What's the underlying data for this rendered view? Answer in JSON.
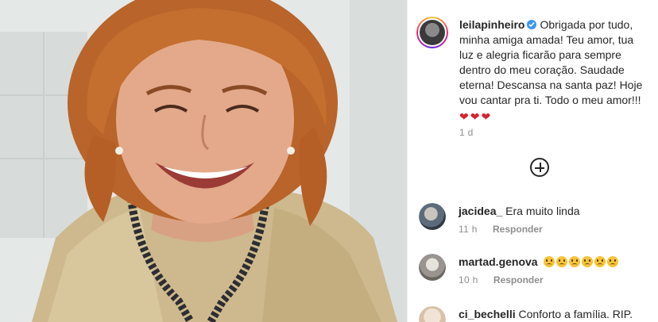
{
  "post": {
    "image_alt": "Smiling woman with short auburn hair wearing a gold satin blouse and beaded necklace"
  },
  "caption": {
    "username": "leilapinheiro",
    "text": "Obrigada por tudo, minha amiga amada! Teu amor, tua luz e alegria ficarão para sempre dentro do meu coração. Saudade eterna! Descansa na santa paz! Hoje vou cantar pra ti. Todo o meu amor!!!",
    "hearts": [
      "❤",
      "❤",
      "❤"
    ],
    "time": "1 d"
  },
  "load_more": {
    "icon": "plus-circle-icon"
  },
  "comments": [
    {
      "username": "jacidea_",
      "text": "Era muito linda",
      "time": "11 h",
      "reply_label": "Responder"
    },
    {
      "username": "martad.genova",
      "text": "",
      "emoji_count": 6,
      "time": "10 h",
      "reply_label": "Responder"
    },
    {
      "username": "ci_bechelli",
      "text": "Conforto a família. RIP.",
      "time": "",
      "reply_label": ""
    }
  ],
  "colors": {
    "verified": "#3897f0",
    "muted": "#8e8e8e",
    "heart": "#d6242f"
  }
}
